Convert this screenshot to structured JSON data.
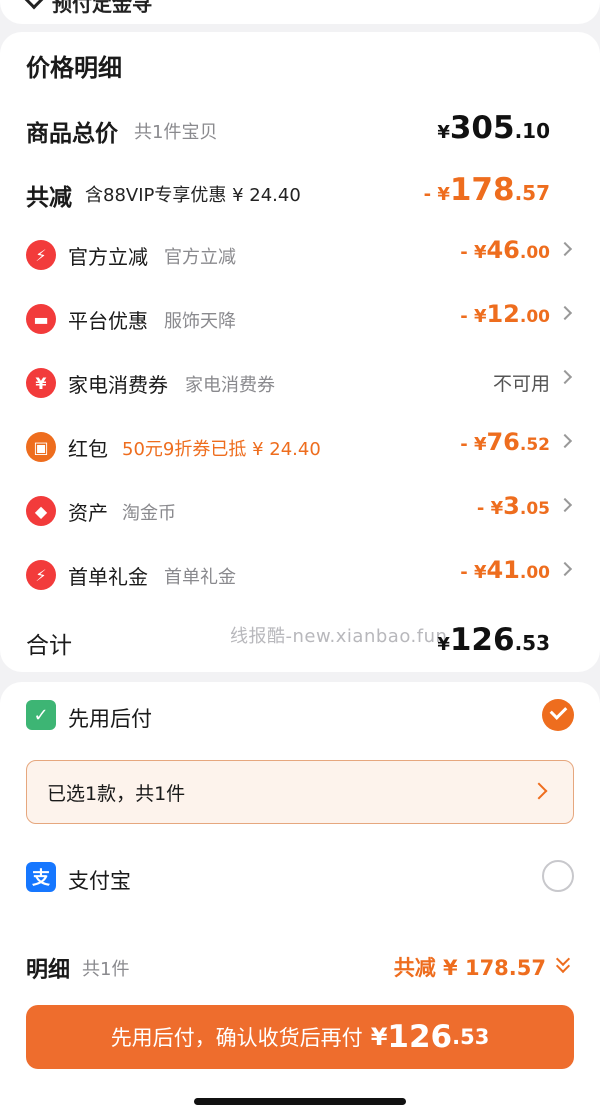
{
  "top": {
    "partial_title": "预付定金寻"
  },
  "price_detail": {
    "title": "价格明细",
    "goods_total": {
      "label": "商品总价",
      "sub": "共1件宝贝",
      "currency": "¥",
      "int": "305",
      "dec": ".10"
    },
    "discount_total": {
      "label": "共减",
      "sub": "含88VIP专享优惠 ¥ 24.40",
      "prefix": "- ¥",
      "int": "178",
      "dec": ".57"
    },
    "items": [
      {
        "icon": "lightning-icon",
        "glyph": "⚡",
        "color": "#f23b3b",
        "label": "官方立减",
        "sub": "官方立减",
        "sub_color": "gray",
        "prefix": "- ¥",
        "int": "46",
        "dec": ".00"
      },
      {
        "icon": "ticket-icon",
        "glyph": "▬",
        "color": "#f23b3b",
        "label": "平台优惠",
        "sub": "服饰天降",
        "sub_color": "gray",
        "prefix": "- ¥",
        "int": "12",
        "dec": ".00"
      },
      {
        "icon": "coupon-icon",
        "glyph": "¥",
        "color": "#f23b3b",
        "label": "家电消费券",
        "sub": "家电消费券",
        "sub_color": "gray",
        "status": "不可用"
      },
      {
        "icon": "red-packet-icon",
        "glyph": "▣",
        "color": "#ee6d1e",
        "label": "红包",
        "sub": "50元9折券已抵 ¥ 24.40",
        "sub_color": "orange",
        "prefix": "- ¥",
        "int": "76",
        "dec": ".52"
      },
      {
        "icon": "tag-icon",
        "glyph": "◆",
        "color": "#f23b3b",
        "label": "资产",
        "sub": "淘金币",
        "sub_color": "gray",
        "prefix": "- ¥",
        "int": "3",
        "dec": ".05"
      },
      {
        "icon": "lightning-icon",
        "glyph": "⚡",
        "color": "#f23b3b",
        "label": "首单礼金",
        "sub": "首单礼金",
        "sub_color": "gray",
        "prefix": "- ¥",
        "int": "41",
        "dec": ".00"
      }
    ],
    "total": {
      "label": "合计",
      "currency": "¥",
      "int": "126",
      "dec": ".53"
    },
    "watermark": "线报酷-new.xianbao.fun"
  },
  "payment": {
    "credit_pay": {
      "label": "先用后付",
      "icon": "bag-icon",
      "color": "#3db574",
      "selected": true
    },
    "selected_summary": "已选1款，共1件",
    "alipay": {
      "label": "支付宝",
      "icon": "alipay-icon",
      "glyph": "支",
      "color": "#1677ff",
      "selected": false
    }
  },
  "footer": {
    "detail_label": "明细",
    "count": "共1件",
    "discount": "共减 ¥ 178.57",
    "button": {
      "text": "先用后付，确认收货后再付",
      "currency": "¥",
      "int": "126",
      "dec": ".53"
    }
  }
}
